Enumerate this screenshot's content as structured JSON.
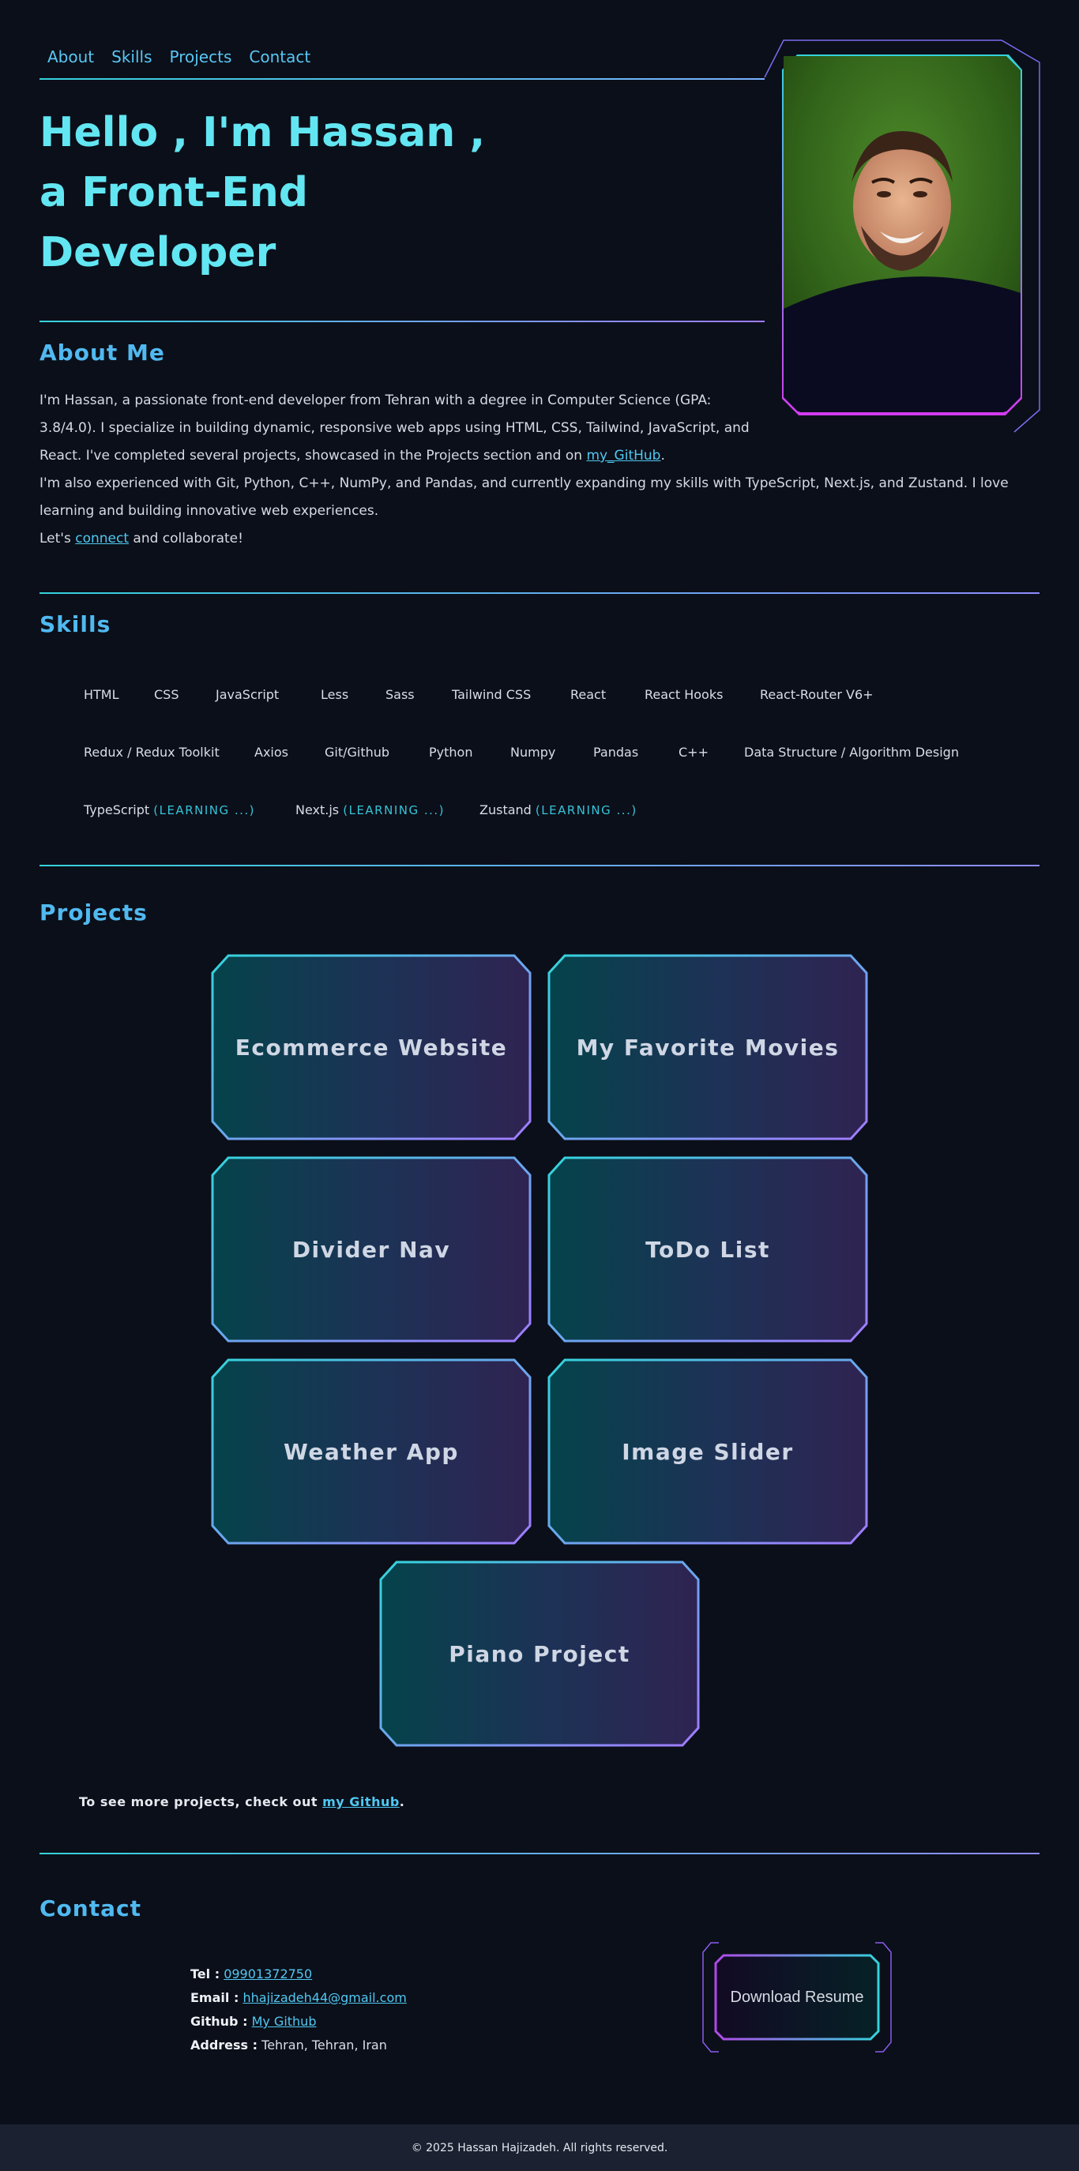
{
  "nav": {
    "items": [
      "About",
      "Skills",
      "Projects",
      "Contact"
    ]
  },
  "hero": {
    "lines": [
      "Hello , I'm Hassan ,",
      "a Front-End",
      "Developer"
    ]
  },
  "about": {
    "heading": "About Me",
    "p1_a": "I'm Hassan, a passionate front-end developer from Tehran with a degree in Computer Science (GPA: 3.8/4.0). I specialize in building dynamic, responsive web apps using HTML, CSS, Tailwind, JavaScript, and React. I've completed several projects, showcased in the Projects section and on ",
    "p1_link": "my_GitHub",
    "p1_end": ".",
    "p2": "I'm also experienced with Git, Python, C++, NumPy, and Pandas, and currently expanding my skills with TypeScript, Next.js, and Zustand. I love learning and building innovative web experiences.",
    "p3_a": "Let's ",
    "p3_link": "connect",
    "p3_b": " and collaborate!"
  },
  "skills": {
    "heading": "Skills",
    "row1": [
      "HTML",
      "CSS",
      "JavaScript",
      "Less",
      "Sass",
      "Tailwind CSS",
      "React",
      "React Hooks",
      "React-Router V6+"
    ],
    "row2": [
      "Redux / Redux Toolkit",
      "Axios",
      "Git/Github",
      "Python",
      "Numpy",
      "Pandas",
      "C++",
      "Data Structure / Algorithm Design"
    ],
    "row3": [
      "TypeScript",
      "Next.js",
      "Zustand"
    ],
    "learning_label": "(LEARNING ...)"
  },
  "projects": {
    "heading": "Projects",
    "items": [
      "Ecommerce Website",
      "My Favorite Movies",
      "Divider Nav",
      "ToDo List",
      "Weather App",
      "Image Slider",
      "Piano Project"
    ],
    "more_a": "To see more projects, check out ",
    "more_link": "my Github",
    "more_end": "."
  },
  "contact": {
    "heading": "Contact",
    "tel_label": "Tel :",
    "tel": "09901372750",
    "email_label": "Email :",
    "email": "hhajizadeh44@gmail.com",
    "github_label": "Github :",
    "github": "My Github",
    "address_label": "Address :",
    "address": "Tehran, Tehran, Iran",
    "resume_button": "Download Resume"
  },
  "footer": {
    "text": "© 2025 Hassan Hajizadeh. All rights reserved."
  },
  "colors": {
    "accent_cyan": "#62e6f2",
    "accent_blue": "#50b9f0",
    "accent_purple": "#a07bff",
    "background": "#0b0f19"
  }
}
